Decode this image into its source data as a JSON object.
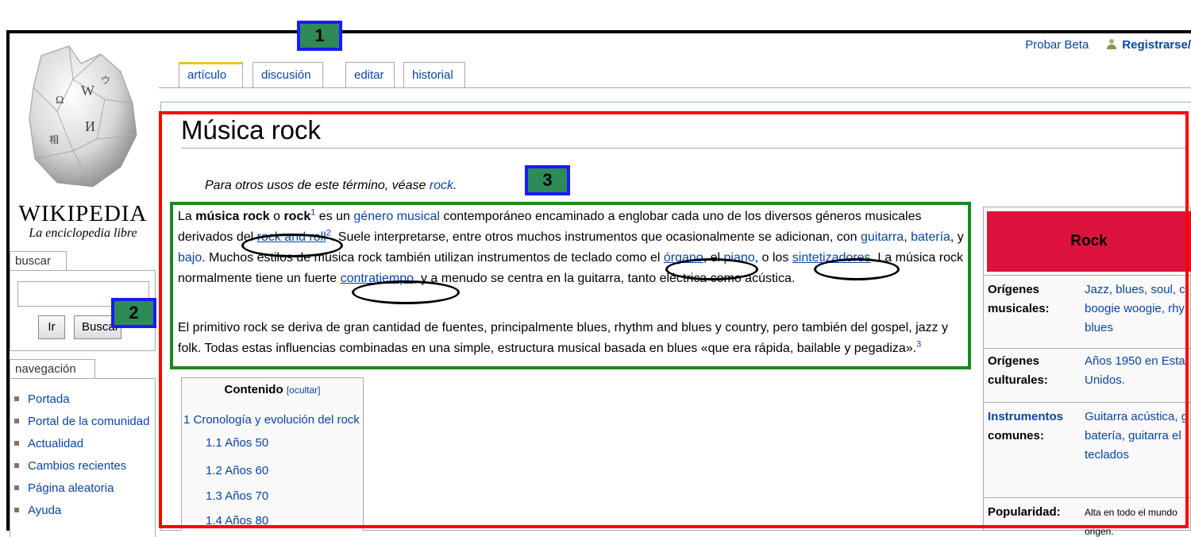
{
  "personal_bar": {
    "beta": "Probar Beta",
    "register": "Registrarse/"
  },
  "logo": {
    "title": "WIKIPEDIA",
    "subtitle": "La enciclopedia libre"
  },
  "tabs": [
    {
      "label": "artículo"
    },
    {
      "label": "discusión"
    },
    {
      "label": "editar"
    },
    {
      "label": "historial"
    }
  ],
  "search": {
    "heading": "buscar",
    "go": "Ir",
    "search": "Buscar"
  },
  "navigation": {
    "heading": "navegación",
    "items": [
      "Portada",
      "Portal de la comunidad",
      "Actualidad",
      "Cambios recientes",
      "Página aleatoria",
      "Ayuda"
    ]
  },
  "page": {
    "title": "Música rock",
    "dab_prefix": "Para otros usos de este término, véase ",
    "dab_link": "rock",
    "dab_suffix": ".",
    "p1": {
      "t1": "La ",
      "b1": "música rock",
      "t2": " o ",
      "b2": "rock",
      "s1": "1",
      "t3": " es un ",
      "l1": "género musical",
      "t4": " contemporáneo encaminado a englobar cada uno de los diversos géneros musicales derivados del ",
      "l2": "rock and roll",
      "s2": "2",
      "t5": ". Suele interpretarse, entre otros muchos instrumentos que ocasionalmente se adicionan, con ",
      "l3": "guitarra",
      "t6": ", ",
      "l4": "batería",
      "t7": ", y ",
      "l5": "bajo",
      "t8": ". Muchos estilos de música rock también utilizan instrumentos de teclado como el ",
      "l6": "órgano",
      "t9": ", el ",
      "l7": "piano",
      "t10": ", o los ",
      "l8": "sintetizadores",
      "t11": ". La música rock normalmente tiene un fuerte ",
      "l9": "contratiempo",
      "t12": ", y a menudo se centra en la guitarra, tanto eléctrica como acústica."
    },
    "p2": {
      "text": "El primitivo rock se deriva de gran cantidad de fuentes, principalmente blues, rhythm and blues y country, pero también del gospel, jazz y folk. Todas estas influencias combinadas en una simple, estructura musical basada en blues «que era rápida, bailable y pegadiza».",
      "sup": "3"
    }
  },
  "toc": {
    "title": "Contenido",
    "hide": "[ocultar]",
    "items": [
      "1 Cronología y evolución del rock",
      "1.1 Años 50",
      "1.2 Años 60",
      "1.3 Años 70",
      "1.4 Años 80"
    ]
  },
  "infobox": {
    "title": "Rock",
    "rows": [
      {
        "label1": "Orígenes",
        "label2": "musicales:",
        "v1": "Jazz, blues, soul, c",
        "v2": "boogie woogie, rhy",
        "v3": "blues"
      },
      {
        "label1": "Orígenes",
        "label2": "culturales:",
        "v1": "Años 1950 en Esta",
        "v2": "Unidos."
      },
      {
        "label1": "Instrumentos",
        "label2": "comunes:",
        "v1": "Guitarra acústica, g",
        "v2": "batería, guitarra el",
        "v3": "teclados"
      },
      {
        "label1": "Popularidad:",
        "v1": "Alta en todo el mundo",
        "v2": "origen."
      }
    ]
  },
  "annotations": {
    "b1": "1",
    "b2": "2",
    "b3": "3"
  },
  "colors": {
    "link": "#0645ad",
    "infobox_header": "#dc143c",
    "annot_red": "#ff0000",
    "annot_green": "#178a1c",
    "badge_fill": "#2e8b57",
    "badge_border": "#1a1aff"
  }
}
